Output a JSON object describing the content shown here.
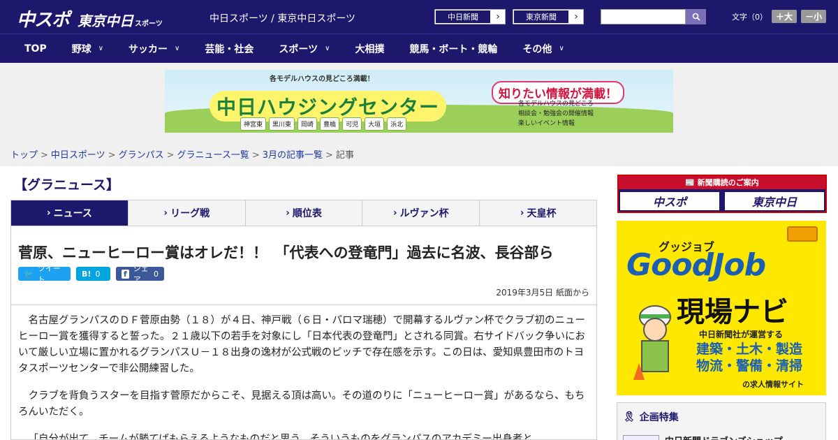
{
  "header": {
    "logo_main": "中スポ",
    "logo_sub": "東京中日",
    "logo_tiny": "スポーツ",
    "site_names": "中日スポーツ / 東京中日スポーツ",
    "ext_links": [
      {
        "label": "中日新聞"
      },
      {
        "label": "東京新聞"
      }
    ],
    "search_placeholder": "",
    "font_size_label": "文字（0）",
    "font_larger": "＋大",
    "font_smaller": "－小"
  },
  "nav": {
    "items": [
      {
        "label": "TOP",
        "dropdown": false
      },
      {
        "label": "野球",
        "dropdown": true
      },
      {
        "label": "サッカー",
        "dropdown": true
      },
      {
        "label": "芸能・社会",
        "dropdown": false
      },
      {
        "label": "スポーツ",
        "dropdown": true
      },
      {
        "label": "大相撲",
        "dropdown": false
      },
      {
        "label": "競馬・ボート・競輪",
        "dropdown": false
      },
      {
        "label": "その他",
        "dropdown": true
      }
    ]
  },
  "banner": {
    "top_note": "各モデルハウスの見どころ満載！",
    "title": "中日ハウジングセンター",
    "info_head": "知りたい情報が満載！",
    "info_list": [
      "各モデルハウスの見どころ",
      "相談会・勉強会の開催情報",
      "楽しいイベント情報"
    ],
    "towns": [
      "神宮東",
      "黒川東",
      "岡崎",
      "豊橋",
      "可児",
      "大垣",
      "浜北"
    ]
  },
  "breadcrumb": {
    "links": [
      "トップ",
      "中日スポーツ",
      "グランパス",
      "グラニュース一覧",
      "3月の記事一覧"
    ],
    "current": "記事"
  },
  "section": {
    "title": "【グラニュース】"
  },
  "tabs": [
    {
      "label": "ニュース",
      "active": true
    },
    {
      "label": "リーグ戦",
      "active": false
    },
    {
      "label": "順位表",
      "active": false
    },
    {
      "label": "ルヴァン杯",
      "active": false
    },
    {
      "label": "天皇杯",
      "active": false
    }
  ],
  "article": {
    "headline": "菅原、ニューヒーロー賞はオレだ！！　「代表への登竜門」過去に名波、長谷部ら",
    "share": {
      "tweet": "ツイート",
      "hatena_count": "0",
      "fb_label": "シェア",
      "fb_count": "0"
    },
    "dateline": "2019年3月5日 紙面から",
    "paragraphs": [
      "名古屋グランパスのＤＦ菅原由勢（１８）が４日、神戸戦（６日・パロマ瑞穂）で開幕するルヴァン杯でクラブ初のニューヒーロー賞を獲得すると誓った。２１歳以下の若手を対象にし「日本代表の登竜門」とされる同賞。右サイドバック争いにおいて厳しい立場に置かれるグランパスＵ－１８出身の逸材が公式戦のピッチで存在感を示す。この日は、愛知県豊田市のトヨタスポーツセンターで非公開練習した。",
      "クラブを背負うスターを目指す菅原だからこそ、見据える頂は高い。その道のりに「ニューヒーロー賞」があるなら、もちろんいただく。",
      "「自分が出て、チームが勝てばもらえるようなものだと思う。そういうものをグランパスのアカデミー出身者と"
    ]
  },
  "sidebar": {
    "subscribe_head": "新聞購読のご案内",
    "subscribe_a": "中スポ",
    "subscribe_b": "東京中日",
    "goodjob": {
      "small": "グッジョブ",
      "big": "GoodJob",
      "navi": "現場ナビ",
      "operator": "中日新聞社が運営する",
      "cats1": "建築・土木・製造",
      "cats2": "物流・警備・清掃",
      "sub": "の求人情報サイト"
    },
    "kikaku_title": "企画特集",
    "kikaku_item": "中日新聞ドラゴンズショップ"
  }
}
